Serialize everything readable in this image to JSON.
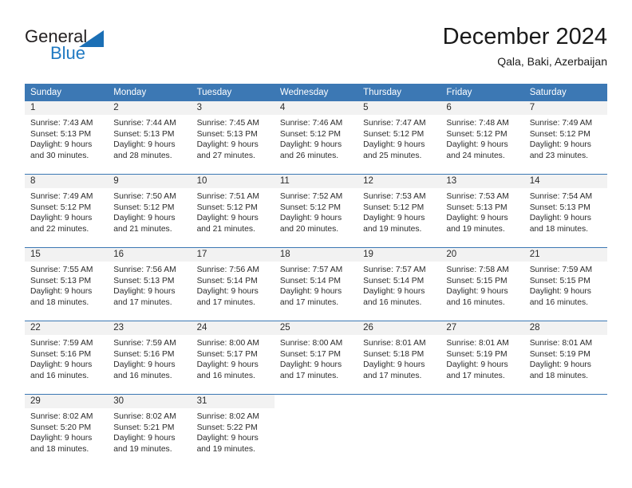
{
  "brand": {
    "name_part1": "General",
    "name_part2": "Blue",
    "triangle_color": "#1b6fb5",
    "blue_text_color": "#1f79c2"
  },
  "header": {
    "title": "December 2024",
    "subtitle": "Qala, Baki, Azerbaijan"
  },
  "theme": {
    "header_bar_color": "#3c78b4",
    "daynum_band_color": "#f2f2f2",
    "text_color": "#2b2b2b"
  },
  "weekday_headers": [
    "Sunday",
    "Monday",
    "Tuesday",
    "Wednesday",
    "Thursday",
    "Friday",
    "Saturday"
  ],
  "weeks": [
    [
      {
        "day": "1",
        "sunrise": "Sunrise: 7:43 AM",
        "sunset": "Sunset: 5:13 PM",
        "daylight1": "Daylight: 9 hours",
        "daylight2": "and 30 minutes."
      },
      {
        "day": "2",
        "sunrise": "Sunrise: 7:44 AM",
        "sunset": "Sunset: 5:13 PM",
        "daylight1": "Daylight: 9 hours",
        "daylight2": "and 28 minutes."
      },
      {
        "day": "3",
        "sunrise": "Sunrise: 7:45 AM",
        "sunset": "Sunset: 5:13 PM",
        "daylight1": "Daylight: 9 hours",
        "daylight2": "and 27 minutes."
      },
      {
        "day": "4",
        "sunrise": "Sunrise: 7:46 AM",
        "sunset": "Sunset: 5:12 PM",
        "daylight1": "Daylight: 9 hours",
        "daylight2": "and 26 minutes."
      },
      {
        "day": "5",
        "sunrise": "Sunrise: 7:47 AM",
        "sunset": "Sunset: 5:12 PM",
        "daylight1": "Daylight: 9 hours",
        "daylight2": "and 25 minutes."
      },
      {
        "day": "6",
        "sunrise": "Sunrise: 7:48 AM",
        "sunset": "Sunset: 5:12 PM",
        "daylight1": "Daylight: 9 hours",
        "daylight2": "and 24 minutes."
      },
      {
        "day": "7",
        "sunrise": "Sunrise: 7:49 AM",
        "sunset": "Sunset: 5:12 PM",
        "daylight1": "Daylight: 9 hours",
        "daylight2": "and 23 minutes."
      }
    ],
    [
      {
        "day": "8",
        "sunrise": "Sunrise: 7:49 AM",
        "sunset": "Sunset: 5:12 PM",
        "daylight1": "Daylight: 9 hours",
        "daylight2": "and 22 minutes."
      },
      {
        "day": "9",
        "sunrise": "Sunrise: 7:50 AM",
        "sunset": "Sunset: 5:12 PM",
        "daylight1": "Daylight: 9 hours",
        "daylight2": "and 21 minutes."
      },
      {
        "day": "10",
        "sunrise": "Sunrise: 7:51 AM",
        "sunset": "Sunset: 5:12 PM",
        "daylight1": "Daylight: 9 hours",
        "daylight2": "and 21 minutes."
      },
      {
        "day": "11",
        "sunrise": "Sunrise: 7:52 AM",
        "sunset": "Sunset: 5:12 PM",
        "daylight1": "Daylight: 9 hours",
        "daylight2": "and 20 minutes."
      },
      {
        "day": "12",
        "sunrise": "Sunrise: 7:53 AM",
        "sunset": "Sunset: 5:12 PM",
        "daylight1": "Daylight: 9 hours",
        "daylight2": "and 19 minutes."
      },
      {
        "day": "13",
        "sunrise": "Sunrise: 7:53 AM",
        "sunset": "Sunset: 5:13 PM",
        "daylight1": "Daylight: 9 hours",
        "daylight2": "and 19 minutes."
      },
      {
        "day": "14",
        "sunrise": "Sunrise: 7:54 AM",
        "sunset": "Sunset: 5:13 PM",
        "daylight1": "Daylight: 9 hours",
        "daylight2": "and 18 minutes."
      }
    ],
    [
      {
        "day": "15",
        "sunrise": "Sunrise: 7:55 AM",
        "sunset": "Sunset: 5:13 PM",
        "daylight1": "Daylight: 9 hours",
        "daylight2": "and 18 minutes."
      },
      {
        "day": "16",
        "sunrise": "Sunrise: 7:56 AM",
        "sunset": "Sunset: 5:13 PM",
        "daylight1": "Daylight: 9 hours",
        "daylight2": "and 17 minutes."
      },
      {
        "day": "17",
        "sunrise": "Sunrise: 7:56 AM",
        "sunset": "Sunset: 5:14 PM",
        "daylight1": "Daylight: 9 hours",
        "daylight2": "and 17 minutes."
      },
      {
        "day": "18",
        "sunrise": "Sunrise: 7:57 AM",
        "sunset": "Sunset: 5:14 PM",
        "daylight1": "Daylight: 9 hours",
        "daylight2": "and 17 minutes."
      },
      {
        "day": "19",
        "sunrise": "Sunrise: 7:57 AM",
        "sunset": "Sunset: 5:14 PM",
        "daylight1": "Daylight: 9 hours",
        "daylight2": "and 16 minutes."
      },
      {
        "day": "20",
        "sunrise": "Sunrise: 7:58 AM",
        "sunset": "Sunset: 5:15 PM",
        "daylight1": "Daylight: 9 hours",
        "daylight2": "and 16 minutes."
      },
      {
        "day": "21",
        "sunrise": "Sunrise: 7:59 AM",
        "sunset": "Sunset: 5:15 PM",
        "daylight1": "Daylight: 9 hours",
        "daylight2": "and 16 minutes."
      }
    ],
    [
      {
        "day": "22",
        "sunrise": "Sunrise: 7:59 AM",
        "sunset": "Sunset: 5:16 PM",
        "daylight1": "Daylight: 9 hours",
        "daylight2": "and 16 minutes."
      },
      {
        "day": "23",
        "sunrise": "Sunrise: 7:59 AM",
        "sunset": "Sunset: 5:16 PM",
        "daylight1": "Daylight: 9 hours",
        "daylight2": "and 16 minutes."
      },
      {
        "day": "24",
        "sunrise": "Sunrise: 8:00 AM",
        "sunset": "Sunset: 5:17 PM",
        "daylight1": "Daylight: 9 hours",
        "daylight2": "and 16 minutes."
      },
      {
        "day": "25",
        "sunrise": "Sunrise: 8:00 AM",
        "sunset": "Sunset: 5:17 PM",
        "daylight1": "Daylight: 9 hours",
        "daylight2": "and 17 minutes."
      },
      {
        "day": "26",
        "sunrise": "Sunrise: 8:01 AM",
        "sunset": "Sunset: 5:18 PM",
        "daylight1": "Daylight: 9 hours",
        "daylight2": "and 17 minutes."
      },
      {
        "day": "27",
        "sunrise": "Sunrise: 8:01 AM",
        "sunset": "Sunset: 5:19 PM",
        "daylight1": "Daylight: 9 hours",
        "daylight2": "and 17 minutes."
      },
      {
        "day": "28",
        "sunrise": "Sunrise: 8:01 AM",
        "sunset": "Sunset: 5:19 PM",
        "daylight1": "Daylight: 9 hours",
        "daylight2": "and 18 minutes."
      }
    ],
    [
      {
        "day": "29",
        "sunrise": "Sunrise: 8:02 AM",
        "sunset": "Sunset: 5:20 PM",
        "daylight1": "Daylight: 9 hours",
        "daylight2": "and 18 minutes."
      },
      {
        "day": "30",
        "sunrise": "Sunrise: 8:02 AM",
        "sunset": "Sunset: 5:21 PM",
        "daylight1": "Daylight: 9 hours",
        "daylight2": "and 19 minutes."
      },
      {
        "day": "31",
        "sunrise": "Sunrise: 8:02 AM",
        "sunset": "Sunset: 5:22 PM",
        "daylight1": "Daylight: 9 hours",
        "daylight2": "and 19 minutes."
      },
      {
        "day": "",
        "sunrise": "",
        "sunset": "",
        "daylight1": "",
        "daylight2": ""
      },
      {
        "day": "",
        "sunrise": "",
        "sunset": "",
        "daylight1": "",
        "daylight2": ""
      },
      {
        "day": "",
        "sunrise": "",
        "sunset": "",
        "daylight1": "",
        "daylight2": ""
      },
      {
        "day": "",
        "sunrise": "",
        "sunset": "",
        "daylight1": "",
        "daylight2": ""
      }
    ]
  ]
}
